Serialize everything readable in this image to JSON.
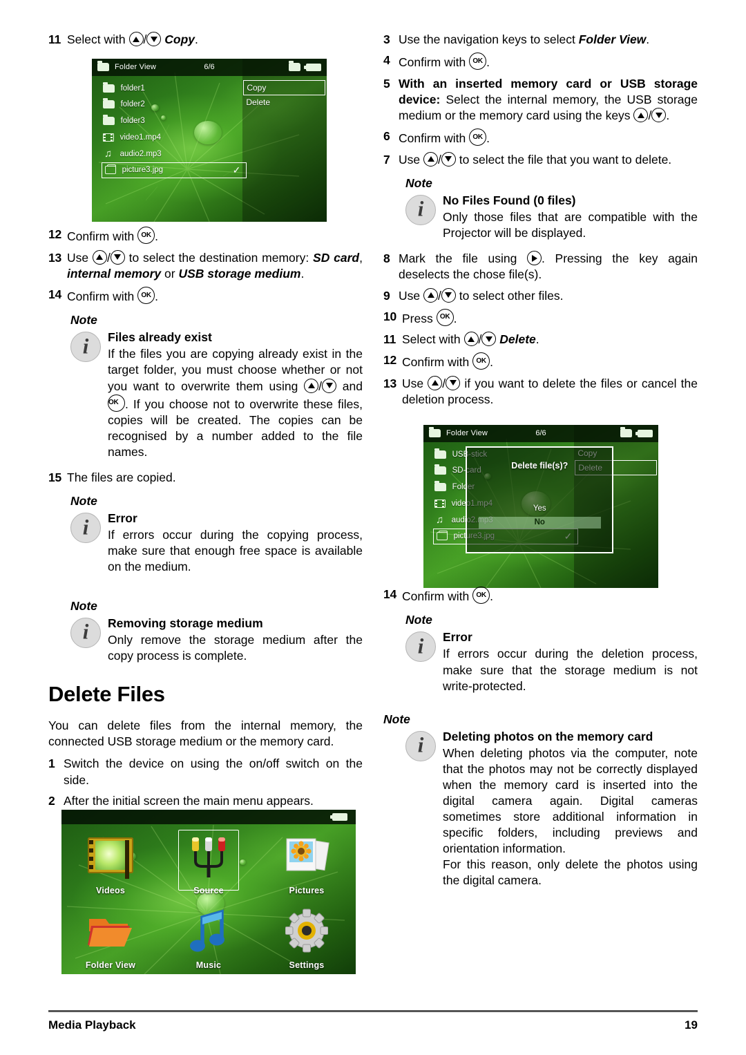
{
  "document": {
    "footer_section": "Media Playback",
    "page_number": "19"
  },
  "left_column": {
    "step11": {
      "num": "11",
      "pre": "Select with",
      "mid": "/",
      "post": "Copy",
      "tail": "."
    },
    "step12": {
      "num": "12",
      "pre": "Confirm with",
      "tail": "."
    },
    "step13": {
      "num": "13",
      "pre": "Use",
      "mid": "/",
      "post": "to select the destination memory:",
      "opt1": "SD card",
      "sep1": ",",
      "opt2": "internal memory",
      "sep2": "or",
      "opt3": "USB storage medium",
      "tail": "."
    },
    "step14": {
      "num": "14",
      "pre": "Confirm with",
      "tail": "."
    },
    "step15": {
      "num": "15",
      "text": "The files are copied."
    },
    "note_files_exist": {
      "label": "Note",
      "title": "Files already exist",
      "text_a": "If the files you are copying already exist in the target folder, you must choose whether or not you want to overwrite them using",
      "text_b": "/",
      "text_c": "and",
      "text_d": ". If you choose not to overwrite these files, copies will be created. The copies can be recognised by a number added to the file names."
    },
    "note_error_copy": {
      "label": "Note",
      "title": "Error",
      "text": "If errors occur during the copying process, make sure that enough free space is available on the medium."
    },
    "note_removing": {
      "label": "Note",
      "title": "Removing storage medium",
      "text": "Only remove the storage medium after the copy process is complete."
    },
    "heading": "Delete Files",
    "intro": "You can delete files from the internal memory, the connected USB storage medium or the memory card.",
    "step1": {
      "num": "1",
      "text": "Switch the device on using the on/off switch on the side."
    },
    "step2": {
      "num": "2",
      "text": "After the initial screen the main menu appears."
    }
  },
  "right_column": {
    "step3": {
      "num": "3",
      "pre": "Use the navigation keys to select",
      "post": "Folder View",
      "tail": "."
    },
    "step4": {
      "num": "4",
      "pre": "Confirm with",
      "tail": "."
    },
    "step5": {
      "num": "5",
      "bold": "With an inserted memory card or USB storage device:",
      "text_a": "Select the internal memory, the USB storage medium or the memory card using the keys",
      "text_b": "/",
      "tail": "."
    },
    "step6": {
      "num": "6",
      "pre": "Confirm with",
      "tail": "."
    },
    "step7": {
      "num": "7",
      "pre": "Use",
      "mid": "/",
      "post": "to select the file that you want to delete."
    },
    "note_no_files": {
      "label": "Note",
      "title": "No Files Found (0 files)",
      "text": "Only those files that are compatible with the Projector will be displayed."
    },
    "step8": {
      "num": "8",
      "pre": "Mark the file using",
      "post": ". Pressing the key again deselects the chose file(s)."
    },
    "step9": {
      "num": "9",
      "pre": "Use",
      "mid": "/",
      "post": "to select other files."
    },
    "step10": {
      "num": "10",
      "pre": "Press",
      "tail": "."
    },
    "step11": {
      "num": "11",
      "pre": "Select with",
      "mid": "/",
      "post": "Delete",
      "tail": "."
    },
    "step12": {
      "num": "12",
      "pre": "Confirm with",
      "tail": "."
    },
    "step13": {
      "num": "13",
      "pre": "Use",
      "mid": "/",
      "post": "if you want to delete the files or cancel the deletion process."
    },
    "step14": {
      "num": "14",
      "pre": "Confirm with",
      "tail": "."
    },
    "note_error_delete": {
      "label": "Note",
      "title": "Error",
      "text": "If errors occur during the deletion process, make sure that the storage medium is not write-protected."
    },
    "note_deleting_photos": {
      "label": "Note",
      "title": "Deleting photos on the memory card",
      "text_a": "When deleting photos via the computer, note that the photos may not be correctly displayed when the memory card is inserted into the digital camera again. Digital cameras sometimes store additional information in specific folders, including previews and orientation information.",
      "text_b": "For this reason, only delete the photos using the digital camera."
    }
  },
  "screenshot_folder_view": {
    "topbar": {
      "title": "Folder View",
      "count": "6/6",
      "folder_icon": "folder-icon",
      "battery_icon": "battery-icon"
    },
    "files": [
      {
        "name": "folder1",
        "icon": "folder-icon",
        "selected": false,
        "checked": false
      },
      {
        "name": "folder2",
        "icon": "folder-icon",
        "selected": false,
        "checked": false
      },
      {
        "name": "folder3",
        "icon": "folder-icon",
        "selected": false,
        "checked": false
      },
      {
        "name": "video1.mp4",
        "icon": "film-icon",
        "selected": false,
        "checked": false
      },
      {
        "name": "audio2.mp3",
        "icon": "note-icon",
        "selected": false,
        "checked": false
      },
      {
        "name": "picture3.jpg",
        "icon": "picture-icon",
        "selected": true,
        "checked": true
      }
    ],
    "context_menu": [
      {
        "label": "Copy",
        "selected": true
      },
      {
        "label": "Delete",
        "selected": false
      }
    ]
  },
  "screenshot_delete_dialog": {
    "topbar": {
      "title": "Folder View",
      "count": "6/6",
      "folder_icon": "folder-icon",
      "battery_icon": "battery-icon"
    },
    "files": [
      {
        "name": "USB-stick",
        "icon": "folder-icon",
        "selected": false,
        "checked": false
      },
      {
        "name": "SD-card",
        "icon": "folder-icon",
        "selected": false,
        "checked": false
      },
      {
        "name": "Folder",
        "icon": "folder-icon",
        "selected": false,
        "checked": false
      },
      {
        "name": "video1.mp4",
        "icon": "film-icon",
        "selected": false,
        "checked": false
      },
      {
        "name": "audio2.mp3",
        "icon": "note-icon",
        "selected": false,
        "checked": false
      },
      {
        "name": "picture3.jpg",
        "icon": "picture-icon",
        "selected": true,
        "checked": true
      }
    ],
    "context_menu": [
      {
        "label": "Copy",
        "selected": false
      },
      {
        "label": "Delete",
        "selected": true
      }
    ],
    "dialog": {
      "question": "Delete file(s)?",
      "yes": "Yes",
      "no": "No",
      "highlighted": "No"
    }
  },
  "screenshot_main_menu": {
    "battery_icon": "battery-icon",
    "items": [
      {
        "label": "Videos",
        "icon": "video-icon",
        "selected": false
      },
      {
        "label": "Source",
        "icon": "source-icon",
        "selected": true
      },
      {
        "label": "Pictures",
        "icon": "pictures-icon",
        "selected": false
      },
      {
        "label": "Folder View",
        "icon": "folder-icon",
        "selected": false
      },
      {
        "label": "Music",
        "icon": "music-icon",
        "selected": false
      },
      {
        "label": "Settings",
        "icon": "settings-icon",
        "selected": false
      }
    ]
  }
}
